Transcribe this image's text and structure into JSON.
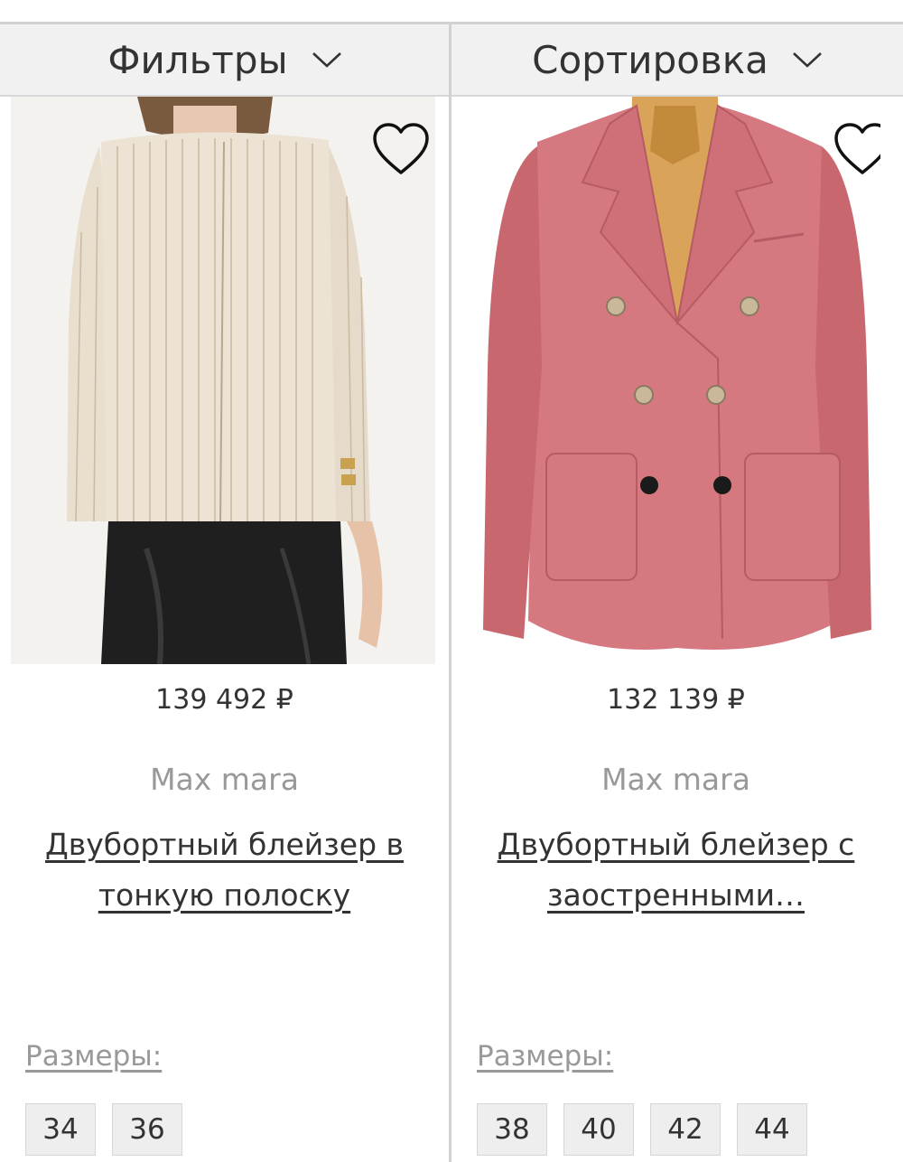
{
  "toolbar": {
    "filters_label": "Фильтры",
    "sort_label": "Сортировка"
  },
  "products": [
    {
      "price": "139 492 ₽",
      "brand": "Max mara",
      "title": "Двубортный блейзер в тонкую полоску",
      "sizes_label": "Размеры:",
      "sizes": [
        "34",
        "36"
      ]
    },
    {
      "price": "132 139 ₽",
      "brand": "Max mara",
      "title": "Двубортный блейзер с заостренными…",
      "sizes_label": "Размеры:",
      "sizes": [
        "38",
        "40",
        "42",
        "44"
      ]
    }
  ],
  "icons": {
    "heart": "heart-outline-icon",
    "chevron": "chevron-down-icon"
  }
}
